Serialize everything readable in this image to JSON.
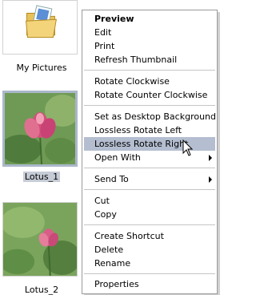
{
  "thumbnails": [
    {
      "caption": "My Pictures",
      "icon": "pictures-folder-icon"
    },
    {
      "caption": "Lotus_1",
      "selected": true
    },
    {
      "caption": "Lotus_2"
    }
  ],
  "menu": {
    "items": [
      {
        "label": "Preview",
        "bold": true
      },
      {
        "label": "Edit"
      },
      {
        "label": "Print"
      },
      {
        "label": "Refresh Thumbnail"
      },
      {
        "label": "Rotate Clockwise"
      },
      {
        "label": "Rotate Counter Clockwise"
      },
      {
        "label": "Set as Desktop Background"
      },
      {
        "label": "Lossless Rotate Left"
      },
      {
        "label": "Lossless Rotate Right",
        "highlighted": true
      },
      {
        "label": "Open With",
        "submenu": true
      },
      {
        "label": "Send To",
        "submenu": true
      },
      {
        "label": "Cut"
      },
      {
        "label": "Copy"
      },
      {
        "label": "Create Shortcut"
      },
      {
        "label": "Delete"
      },
      {
        "label": "Rename"
      },
      {
        "label": "Properties"
      }
    ]
  },
  "colors": {
    "highlight": "#b4bed0",
    "selection_border": "#aab7ca"
  }
}
